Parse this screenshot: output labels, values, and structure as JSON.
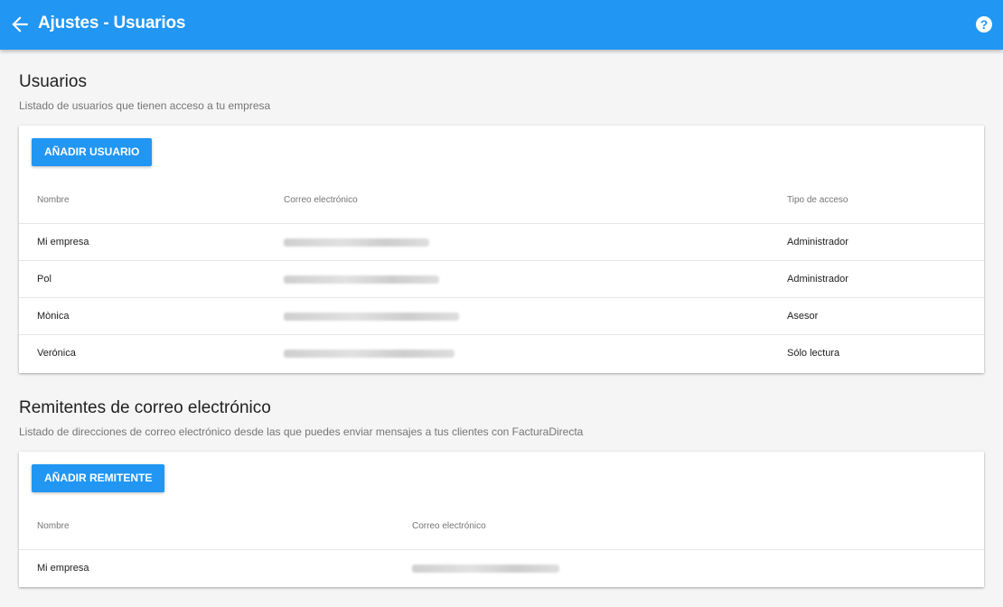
{
  "header": {
    "title": "Ajustes - Usuarios",
    "help_label": "?",
    "color": "#2196f3"
  },
  "users_section": {
    "title": "Usuarios",
    "subtitle": "Listado de usuarios que tienen acceso a tu empresa",
    "add_button": "AÑADIR USUARIO",
    "columns": [
      "Nombre",
      "Correo electrónico",
      "Tipo de acceso"
    ],
    "rows": [
      {
        "name": "Mi empresa",
        "email": "",
        "access": "Administrador"
      },
      {
        "name": "Pol",
        "email": "",
        "access": "Administrador"
      },
      {
        "name": "Mònica",
        "email": "",
        "access": "Asesor"
      },
      {
        "name": "Verónica",
        "email": "",
        "access": "Sólo lectura"
      }
    ]
  },
  "senders_section": {
    "title": "Remitentes de correo electrónico",
    "subtitle": "Listado de direcciones de correo electrónico desde las que puedes enviar mensajes a tus clientes con FacturaDirecta",
    "add_button": "AÑADIR REMITENTE",
    "columns": [
      "Nombre",
      "Correo electrónico"
    ],
    "rows": [
      {
        "name": "Mi empresa",
        "email": ""
      }
    ]
  }
}
